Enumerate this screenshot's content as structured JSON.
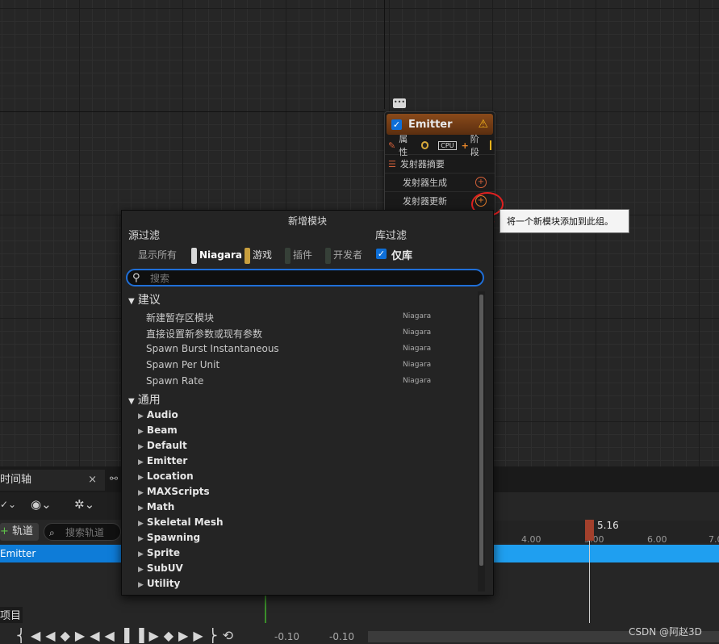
{
  "graph": {
    "comment_icon": "comment-icon"
  },
  "node": {
    "title": "Emitter",
    "properties_label": "属性",
    "cpu_label": "CPU",
    "stage_label": "阶段",
    "summary_label": "发射器摘要",
    "spawn_label": "发射器生成",
    "update_label": "发射器更新"
  },
  "tooltip": {
    "text": "将一个新模块添加到此组。"
  },
  "popup": {
    "title": "新增模块",
    "source_filter_label": "源过滤",
    "library_filter_label": "库过滤",
    "filters": [
      "显示所有",
      "Niagara",
      "游戏",
      "插件",
      "开发者"
    ],
    "library_only_label": "仅库",
    "search_placeholder": "搜索",
    "categories": [
      {
        "name": "建议",
        "items": [
          {
            "name": "新建暂存区模块",
            "source": "Niagara"
          },
          {
            "name": "直接设置新参数或现有参数",
            "source": "Niagara"
          },
          {
            "name": "Spawn Burst Instantaneous",
            "source": "Niagara"
          },
          {
            "name": "Spawn Per Unit",
            "source": "Niagara"
          },
          {
            "name": "Spawn Rate",
            "source": "Niagara"
          }
        ]
      },
      {
        "name": "通用",
        "groups": [
          "Audio",
          "Beam",
          "Default",
          "Emitter",
          "Location",
          "MAXScripts",
          "Math",
          "Skeletal Mesh",
          "Spawning",
          "Sprite",
          "SubUV",
          "Utility"
        ]
      }
    ]
  },
  "timeline": {
    "tab_title": "时间轴",
    "track_button": "轨道",
    "search_placeholder": "搜索轨道",
    "row_label": "Emitter",
    "marker_value": "5.16",
    "ticks": [
      "4.00",
      "5.00",
      "6.00",
      "7.0"
    ],
    "project_label": "项目",
    "range_start": "-0.10",
    "range_end": "-0.10"
  },
  "watermark": "CSDN @阿赵3D",
  "colors": {
    "accent": "#1f6fd8",
    "emitter_header": "#8a4a1a",
    "timeline_track": "#1f9ff0"
  }
}
